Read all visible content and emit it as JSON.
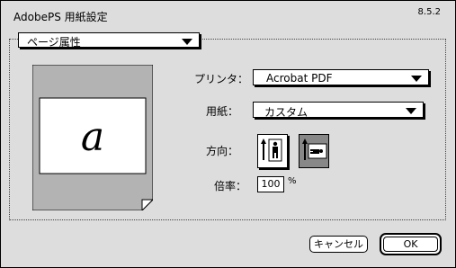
{
  "window": {
    "title": "AdobePS 用紙設定",
    "version": "8.5.2"
  },
  "section_popup": {
    "selected": "ページ属性"
  },
  "preview": {
    "glyph": "a"
  },
  "printer": {
    "label": "プリンタ：",
    "selected": "Acrobat PDF"
  },
  "paper": {
    "label": "用紙：",
    "selected": "カスタム"
  },
  "orientation": {
    "label": "方向：",
    "options": [
      "portrait",
      "landscape"
    ],
    "selected": "landscape"
  },
  "scale": {
    "label": "倍率：",
    "value": "100",
    "unit": "%"
  },
  "buttons": {
    "cancel": "キャンセル",
    "ok": "OK"
  }
}
